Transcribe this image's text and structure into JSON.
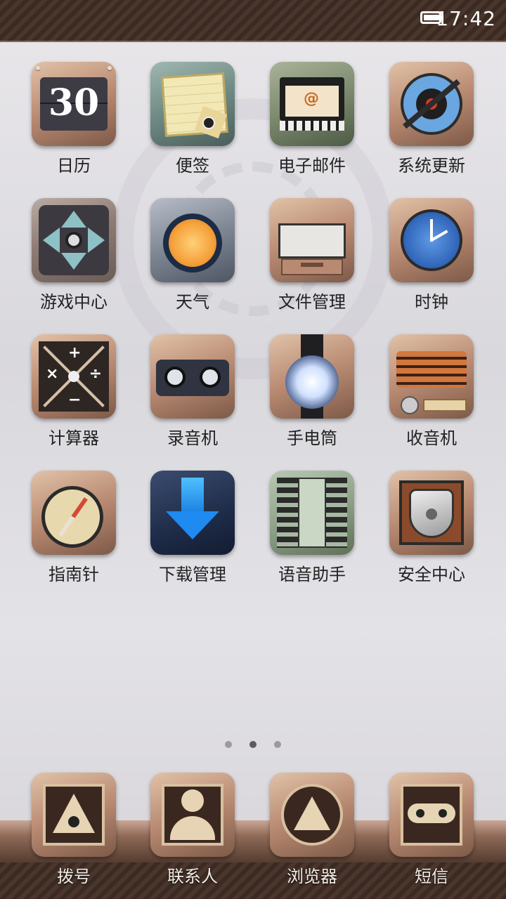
{
  "status_bar": {
    "time": "17:42",
    "battery_level_percent": 90
  },
  "colors": {
    "accent": "#4a362c",
    "label_text": "#222222",
    "dock_label": "#f3ece6"
  },
  "apps": [
    {
      "label": "日历",
      "icon": "calendar-icon",
      "day": "30"
    },
    {
      "label": "便签",
      "icon": "notes-icon"
    },
    {
      "label": "电子邮件",
      "icon": "email-icon"
    },
    {
      "label": "系统更新",
      "icon": "system-update-icon"
    },
    {
      "label": "游戏中心",
      "icon": "game-center-icon"
    },
    {
      "label": "天气",
      "icon": "weather-icon"
    },
    {
      "label": "文件管理",
      "icon": "file-manager-icon"
    },
    {
      "label": "时钟",
      "icon": "clock-icon"
    },
    {
      "label": "计算器",
      "icon": "calculator-icon"
    },
    {
      "label": "录音机",
      "icon": "recorder-icon"
    },
    {
      "label": "手电筒",
      "icon": "flashlight-icon"
    },
    {
      "label": "收音机",
      "icon": "radio-icon"
    },
    {
      "label": "指南针",
      "icon": "compass-icon"
    },
    {
      "label": "下载管理",
      "icon": "download-manager-icon"
    },
    {
      "label": "语音助手",
      "icon": "voice-assistant-icon"
    },
    {
      "label": "安全中心",
      "icon": "security-center-icon"
    }
  ],
  "page_indicator": {
    "count": 3,
    "active_index": 1
  },
  "dock": [
    {
      "label": "拨号",
      "icon": "dialer-icon"
    },
    {
      "label": "联系人",
      "icon": "contacts-icon"
    },
    {
      "label": "浏览器",
      "icon": "browser-icon"
    },
    {
      "label": "短信",
      "icon": "sms-icon"
    }
  ]
}
